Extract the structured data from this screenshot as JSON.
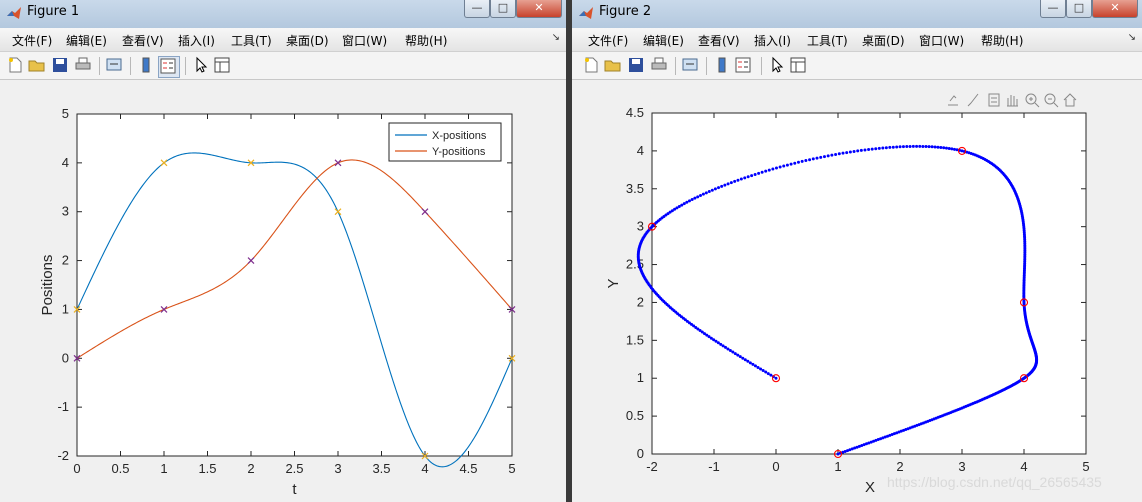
{
  "window1": {
    "title": "Figure 1",
    "menu": [
      "文件(F)",
      "编辑(E)",
      "查看(V)",
      "插入(I)",
      "工具(T)",
      "桌面(D)",
      "窗口(W)",
      "帮助(H)"
    ]
  },
  "window2": {
    "title": "Figure 2",
    "menu": [
      "文件(F)",
      "编辑(E)",
      "查看(V)",
      "插入(I)",
      "工具(T)",
      "桌面(D)",
      "窗口(W)",
      "帮助(H)"
    ]
  },
  "window_buttons": {
    "minimize": "—",
    "maximize": "□",
    "close": "✕"
  },
  "toolbar_icons": [
    "new-file-icon",
    "open-folder-icon",
    "save-icon",
    "print-icon",
    "link-icon",
    "colorbar-icon",
    "legend-icon",
    "cursor-icon",
    "property-inspector-icon"
  ],
  "axes_toolbar_icons": [
    "export-icon",
    "brush-icon",
    "datatip-icon",
    "pan-icon",
    "zoom-in-icon",
    "zoom-out-icon",
    "home-icon"
  ],
  "watermark": "https://blog.csdn.net/qq_26565435",
  "colors": {
    "x_series": "#0072BD",
    "y_series": "#D95319",
    "marker_yellow": "#EDB120",
    "marker_purple": "#7E2F8E",
    "curve2": "#0000FF",
    "waypoint": "#FF0000"
  },
  "chart_data": [
    {
      "type": "line",
      "xlabel": "t",
      "ylabel": "Positions",
      "xlim": [
        0,
        5
      ],
      "ylim": [
        -2,
        5
      ],
      "xticks": [
        0,
        0.5,
        1,
        1.5,
        2,
        2.5,
        3,
        3.5,
        4,
        4.5,
        5
      ],
      "yticks": [
        -2,
        -1,
        0,
        1,
        2,
        3,
        4,
        5
      ],
      "legend_position": "top-right",
      "series": [
        {
          "name": "X-positions",
          "color": "#0072BD",
          "x": [
            0,
            1,
            2,
            3,
            4,
            5
          ],
          "values": [
            1,
            4,
            4,
            3,
            -2,
            0
          ]
        },
        {
          "name": "Y-positions",
          "color": "#D95319",
          "x": [
            0,
            1,
            2,
            3,
            4,
            5
          ],
          "values": [
            0,
            1,
            2,
            4,
            3,
            1
          ]
        }
      ]
    },
    {
      "type": "scatter",
      "xlabel": "X",
      "ylabel": "Y",
      "xlim": [
        -2,
        5
      ],
      "ylim": [
        0,
        4.5
      ],
      "xticks": [
        -2,
        -1,
        0,
        1,
        2,
        3,
        4,
        5
      ],
      "yticks": [
        0,
        0.5,
        1,
        1.5,
        2,
        2.5,
        3,
        3.5,
        4,
        4.5
      ],
      "waypoints": {
        "x": [
          1,
          4,
          4,
          3,
          -2,
          0
        ],
        "y": [
          0,
          1,
          2,
          4,
          3,
          1
        ]
      }
    }
  ]
}
